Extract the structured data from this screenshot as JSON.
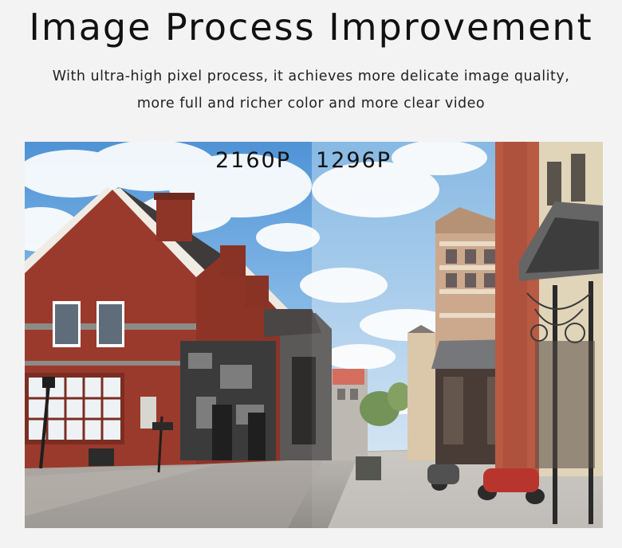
{
  "headline": "Image Process Improvement",
  "description": {
    "line1": "With ultra-high pixel process, it achieves more delicate image quality,",
    "line2": "more full and richer color and more clear video"
  },
  "comparison": {
    "left_label": "2160P",
    "right_label": "1296P"
  },
  "colors": {
    "background": "#f3f3f3",
    "brick": "#9a3a2c",
    "sky": "#8fc0ea"
  }
}
